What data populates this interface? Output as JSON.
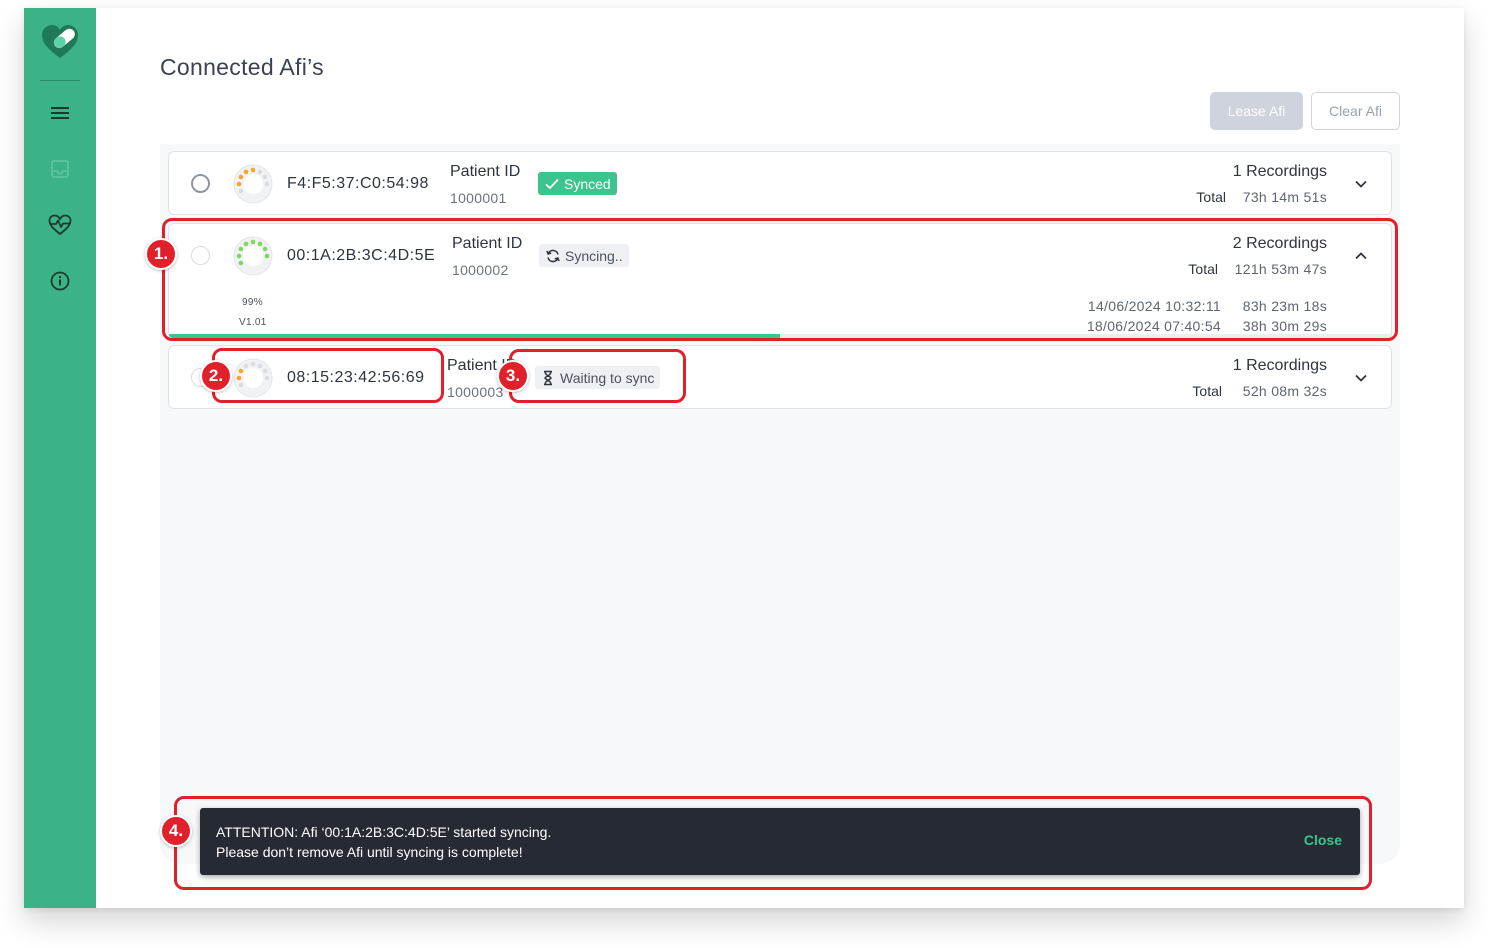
{
  "page": {
    "title": "Connected Afi’s"
  },
  "actions": {
    "lease_label": "Lease Afi",
    "clear_label": "Clear Afi"
  },
  "sidebar": {
    "accent": "#3bb386",
    "items": [
      {
        "name": "menu",
        "icon": "menu-icon"
      },
      {
        "name": "inbox",
        "icon": "inbox-icon"
      },
      {
        "name": "heart-rate",
        "icon": "heart-pulse-icon"
      },
      {
        "name": "info",
        "icon": "info-icon"
      }
    ]
  },
  "devices": [
    {
      "mac": "F4:F5:37:C0:54:98",
      "patient_label": "Patient ID",
      "patient_id": "1000001",
      "status": "Synced",
      "recordings": "1 Recordings",
      "total_label": "Total",
      "total": "73h 14m 51s",
      "expanded": false
    },
    {
      "mac": "00:1A:2B:3C:4D:5E",
      "patient_label": "Patient ID",
      "patient_id": "1000002",
      "status": "Syncing..",
      "recordings": "2 Recordings",
      "total_label": "Total",
      "total": "121h 53m 47s",
      "expanded": true,
      "battery": "99%",
      "version": "V1.01",
      "sync_progress": 0.5,
      "sessions": [
        {
          "date": "14/06/2024 10:32:11",
          "duration": "83h 23m 18s"
        },
        {
          "date": "18/06/2024 07:40:54",
          "duration": "38h 30m 29s"
        }
      ]
    },
    {
      "mac": "08:15:23:42:56:69",
      "patient_label": "Patient ID",
      "patient_id": "1000003",
      "status": "Waiting to sync",
      "recordings": "1 Recordings",
      "total_label": "Total",
      "total": "52h 08m 32s",
      "expanded": false
    }
  ],
  "toast": {
    "line1": "ATTENTION: Afi ‘00:1A:2B:3C:4D:5E’ started syncing.",
    "line2": "Please don’t remove Afi until syncing is complete!",
    "close_label": "Close"
  },
  "callouts": [
    "1.",
    "2.",
    "3.",
    "4."
  ],
  "colors": {
    "highlight": "#e0202b",
    "synced": "#3bc48d",
    "toast_bg": "#262a33"
  }
}
